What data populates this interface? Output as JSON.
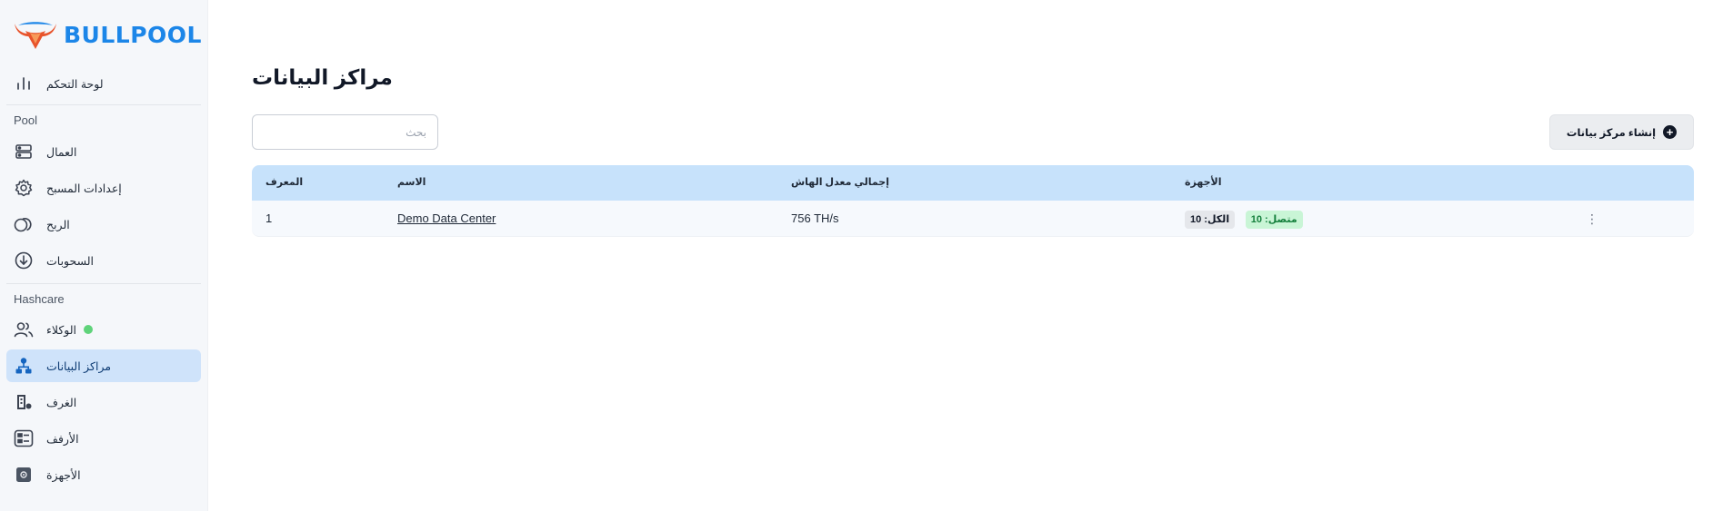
{
  "brand": {
    "name": "BULLPOOL",
    "accent": "#1c86e8",
    "horns": "#e8542c"
  },
  "sidebar": {
    "dashboard": {
      "label": "لوحة التحكم",
      "icon": "bar-chart-icon"
    },
    "sections": [
      {
        "label": "Pool"
      },
      {
        "label": "Hashcare"
      }
    ],
    "items": [
      {
        "label": "العمال",
        "icon": "server-icon"
      },
      {
        "label": "إعدادات المسبح",
        "icon": "gear-icon"
      },
      {
        "label": "الربح",
        "icon": "coins-icon"
      },
      {
        "label": "السحوبات",
        "icon": "download-circle-icon"
      },
      {
        "label": "الوكلاء",
        "icon": "users-icon",
        "status": "online"
      },
      {
        "label": "مراكز البيانات",
        "icon": "sitemap-icon",
        "active": true
      },
      {
        "label": "الغرف",
        "icon": "room-icon"
      },
      {
        "label": "الأرفف",
        "icon": "rack-icon"
      },
      {
        "label": "الأجهزة",
        "icon": "device-icon"
      }
    ]
  },
  "main": {
    "title": "مراكز البيانات",
    "search": {
      "placeholder": "بحث",
      "value": ""
    },
    "create_button": "إنشاء مركز بيانات",
    "table": {
      "columns": [
        "المعرف",
        "الاسم",
        "إجمالي معدل الهاش",
        "الأجهزة"
      ],
      "rows": [
        {
          "id": "1",
          "name": "Demo Data Center",
          "hashrate": "756 TH/s",
          "devices_total": "الكل: 10",
          "devices_online": "متصل: 10"
        }
      ]
    }
  }
}
